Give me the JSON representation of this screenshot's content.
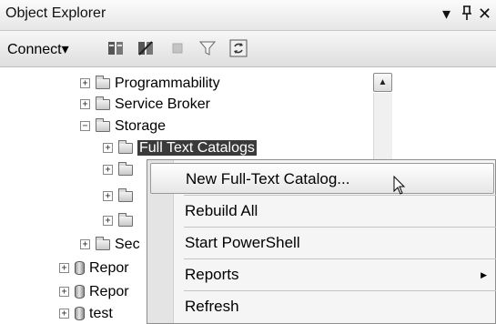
{
  "window": {
    "title": "Object Explorer",
    "controls": {
      "dropdown": "▾",
      "pin": "↕",
      "close": "✕"
    }
  },
  "toolbar": {
    "connect_label": "Connect",
    "connect_arrow": "▾"
  },
  "tree": {
    "items": [
      {
        "label": "Programmability",
        "expander": "+",
        "icon": "folder-icon"
      },
      {
        "label": "Service Broker",
        "expander": "+",
        "icon": "folder-icon"
      },
      {
        "label": "Storage",
        "expander": "−",
        "icon": "folder-icon"
      },
      {
        "label": "Full Text Catalogs",
        "expander": "+",
        "icon": "folder-icon",
        "selected": true
      },
      {
        "label": "",
        "expander": "+",
        "icon": "folder-icon"
      },
      {
        "label": "",
        "expander": "+",
        "icon": "folder-icon"
      },
      {
        "label": "",
        "expander": "+",
        "icon": "folder-icon"
      },
      {
        "label": "Sec",
        "expander": "+",
        "icon": "folder-icon"
      },
      {
        "label": "Repor",
        "expander": "+",
        "icon": "database-icon"
      },
      {
        "label": "Repor",
        "expander": "+",
        "icon": "database-icon"
      },
      {
        "label": "test",
        "expander": "+",
        "icon": "database-icon"
      }
    ]
  },
  "scrollbar": {
    "up_arrow": "▲"
  },
  "context_menu": {
    "items": [
      {
        "label": "New Full-Text Catalog...",
        "highlighted": true
      },
      {
        "label": "Rebuild All"
      },
      {
        "label": "Start PowerShell"
      },
      {
        "label": "Reports",
        "submenu_arrow": "▶"
      },
      {
        "label": "Refresh"
      }
    ]
  }
}
